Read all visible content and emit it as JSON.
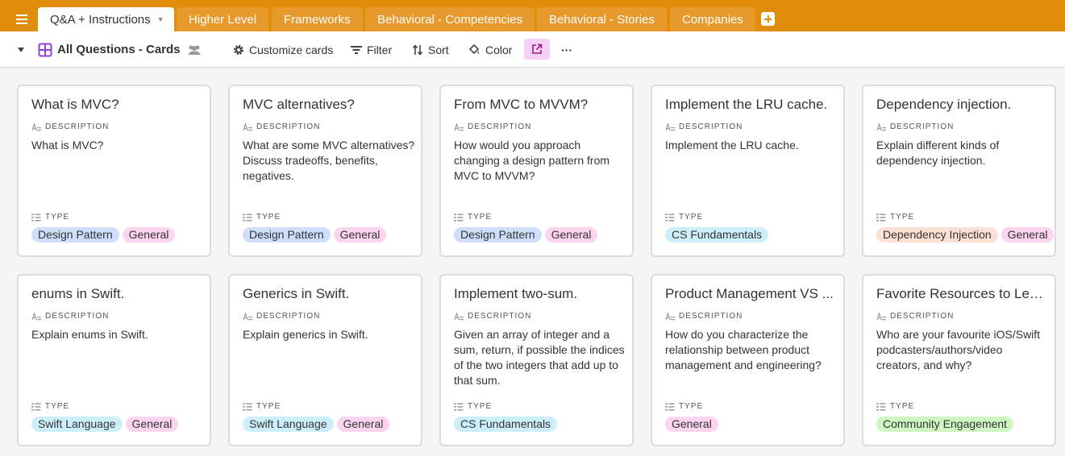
{
  "tabs": [
    {
      "label": "Q&A + Instructions",
      "active": true
    },
    {
      "label": "Higher Level",
      "active": false
    },
    {
      "label": "Frameworks",
      "active": false
    },
    {
      "label": "Behavioral - Competencies",
      "active": false
    },
    {
      "label": "Behavioral - Stories",
      "active": false
    },
    {
      "label": "Companies",
      "active": false
    }
  ],
  "toolbar": {
    "view_name": "All Questions - Cards",
    "customize_label": "Customize cards",
    "filter_label": "Filter",
    "sort_label": "Sort",
    "color_label": "Color",
    "more_label": "···"
  },
  "field_labels": {
    "description": "DESCRIPTION",
    "type": "TYPE"
  },
  "colors": {
    "brand": "#e08d0b",
    "tag_design_pattern": "#cfdffb",
    "tag_general": "#fbd4f0",
    "tag_cs_fundamentals": "#cdeffb",
    "tag_swift_language": "#cdeffb",
    "tag_dependency_injection": "#fde0d4",
    "tag_community_engagement": "#cff5c3"
  },
  "cards": [
    {
      "title": "What is MVC?",
      "description": "What is MVC?",
      "tags": [
        {
          "label": "Design Pattern",
          "color": "blue"
        },
        {
          "label": "General",
          "color": "pink"
        }
      ]
    },
    {
      "title": "MVC alternatives?",
      "description": "What are some MVC alternatives? Discuss tradeoffs, benefits, negatives.",
      "tags": [
        {
          "label": "Design Pattern",
          "color": "blue"
        },
        {
          "label": "General",
          "color": "pink"
        }
      ]
    },
    {
      "title": "From MVC to MVVM?",
      "description": "How would you approach changing a design pattern from MVC to MVVM?",
      "tags": [
        {
          "label": "Design Pattern",
          "color": "blue"
        },
        {
          "label": "General",
          "color": "pink"
        }
      ]
    },
    {
      "title": "Implement the LRU cache.",
      "description": "Implement the LRU cache.",
      "tags": [
        {
          "label": "CS Fundamentals",
          "color": "cyan"
        }
      ]
    },
    {
      "title": "Dependency injection.",
      "description": "Explain different kinds of dependency injection.",
      "tags": [
        {
          "label": "Dependency Injection",
          "color": "orange"
        },
        {
          "label": "General",
          "color": "pink"
        }
      ]
    },
    {
      "title": "enums in Swift.",
      "description": "Explain enums in Swift.",
      "tags": [
        {
          "label": "Swift Language",
          "color": "cyan"
        },
        {
          "label": "General",
          "color": "pink"
        }
      ]
    },
    {
      "title": "Generics in Swift.",
      "description": "Explain generics in Swift.",
      "tags": [
        {
          "label": "Swift Language",
          "color": "cyan"
        },
        {
          "label": "General",
          "color": "pink"
        }
      ]
    },
    {
      "title": "Implement two-sum.",
      "description": "Given an array of integer and a sum, return, if possible the indices of the two integers that add up to that sum.",
      "tags": [
        {
          "label": "CS Fundamentals",
          "color": "cyan"
        }
      ]
    },
    {
      "title": "Product Management VS ...",
      "description": "How do you characterize the relationship between product management and engineering?",
      "tags": [
        {
          "label": "General",
          "color": "pink"
        }
      ]
    },
    {
      "title": "Favorite Resources to Lea...",
      "description": "Who are your favourite iOS/Swift podcasters/authors/video creators, and why?",
      "tags": [
        {
          "label": "Community Engagement",
          "color": "green"
        }
      ]
    }
  ]
}
